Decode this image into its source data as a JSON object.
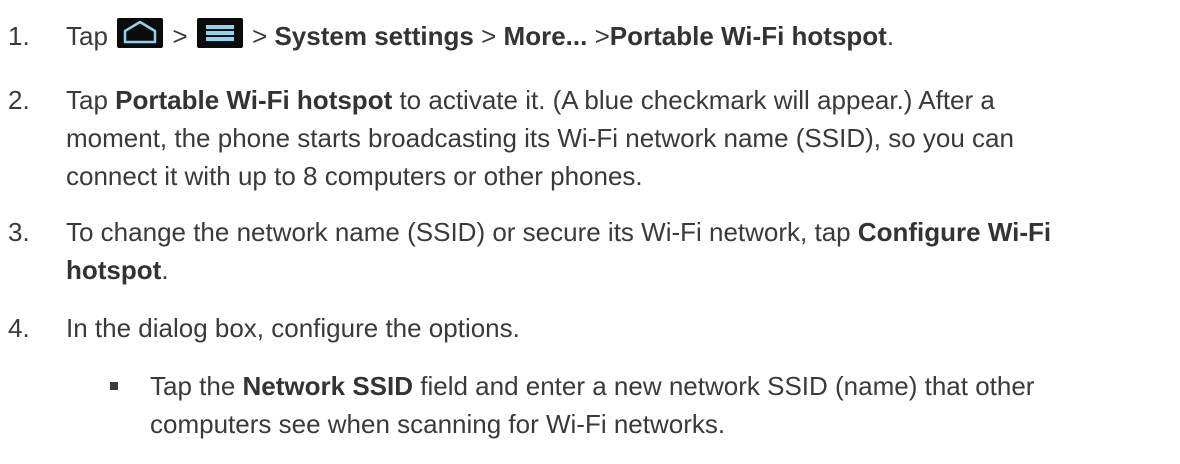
{
  "steps": [
    {
      "number": "1.",
      "tap": "Tap",
      "sep": ">",
      "path": [
        "System settings",
        "More...",
        "Portable Wi-Fi hotspot"
      ],
      "end": "."
    },
    {
      "number": "2.",
      "pre": "Tap ",
      "bold": "Portable Wi-Fi hotspot",
      "post": " to activate it. (A blue checkmark will appear.) After a",
      "line2": "moment, the phone starts broadcasting its Wi-Fi network name (SSID), so you can",
      "line3": "connect it with up to 8 computers or other phones."
    },
    {
      "number": "3.",
      "pre": "To change the network name (SSID) or secure its Wi-Fi network, tap ",
      "bold1": "Configure Wi-Fi",
      "bold2": "hotspot",
      "end": "."
    },
    {
      "number": "4.",
      "text": "In the dialog box, configure the options."
    }
  ],
  "bullet": {
    "pre": "Tap the ",
    "bold": "Network SSID",
    "post": " field and enter a new network SSID (name) that other",
    "line2": "computers see when scanning for Wi-Fi networks."
  },
  "icons": [
    "home-icon",
    "menu-icon"
  ]
}
